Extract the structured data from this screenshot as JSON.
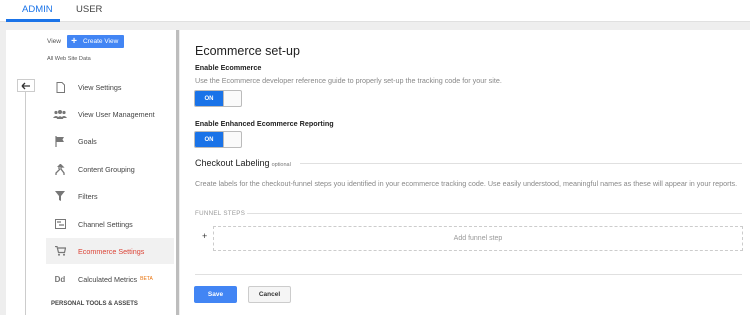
{
  "tabs": {
    "admin": "ADMIN",
    "user": "USER"
  },
  "sidebar": {
    "view_label": "View",
    "create_view": "Create View",
    "view_name": "All Web Site Data",
    "items": [
      {
        "label": "View Settings",
        "icon": "document-icon"
      },
      {
        "label": "View User Management",
        "icon": "people-icon"
      },
      {
        "label": "Goals",
        "icon": "flag-icon"
      },
      {
        "label": "Content Grouping",
        "icon": "grouping-icon"
      },
      {
        "label": "Filters",
        "icon": "filter-icon"
      },
      {
        "label": "Channel Settings",
        "icon": "channel-icon"
      },
      {
        "label": "Ecommerce Settings",
        "icon": "cart-icon",
        "active": true
      },
      {
        "label": "Calculated Metrics",
        "icon": "dd-icon",
        "badge": "BETA"
      }
    ],
    "section_title": "PERSONAL TOOLS & ASSETS"
  },
  "main": {
    "title": "Ecommerce set-up",
    "enable_ecommerce": {
      "label": "Enable Ecommerce",
      "description": "Use the Ecommerce developer reference guide to properly set-up the tracking code for your site.",
      "state": "ON"
    },
    "enhanced": {
      "label": "Enable Enhanced Ecommerce Reporting",
      "state": "ON"
    },
    "checkout": {
      "title": "Checkout Labeling",
      "optional": "optional",
      "description": "Create labels for the checkout-funnel steps you identified in your ecommerce tracking code. Use easily understood, meaningful names as these will appear in your reports."
    },
    "funnel_steps": "FUNNEL STEPS",
    "add_step_plus": "+",
    "add_step": "Add funnel step",
    "save": "Save",
    "cancel": "Cancel"
  },
  "colors": {
    "accent": "#1a73e8",
    "active_nav": "#db4437",
    "beta": "#e8710a"
  }
}
